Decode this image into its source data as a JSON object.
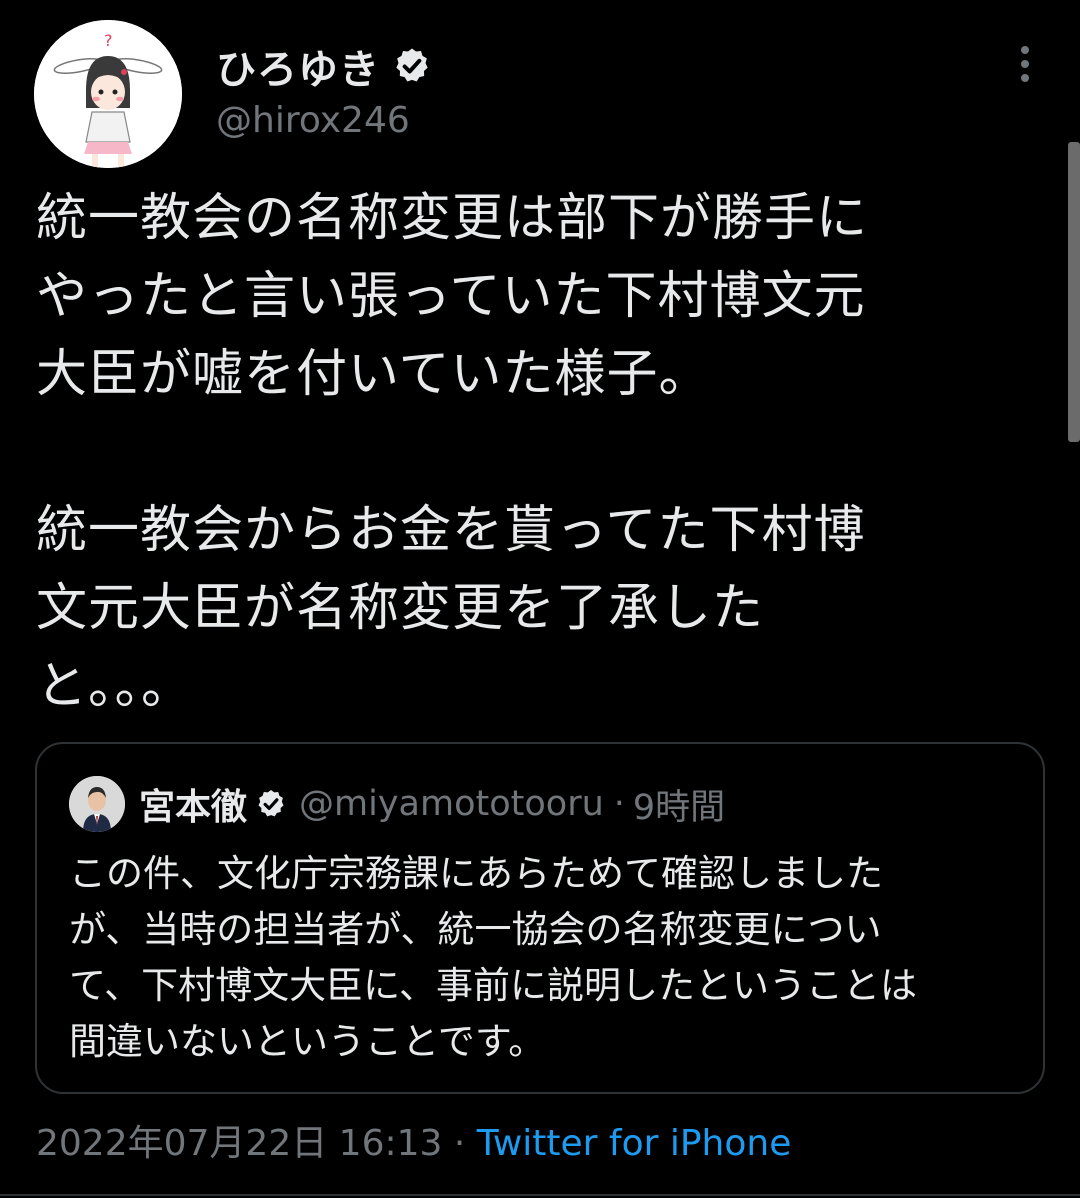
{
  "author": {
    "display_name": "ひろゆき",
    "handle": "@hirox246",
    "verified": true,
    "avatar_icon": "avatar-bunny-girl-icon"
  },
  "tweet": {
    "text": "統一教会の名称変更は部下が勝手に\nやったと言い張っていた下村博文元\n大臣が嘘を付いていた様子。\n\n統一教会からお金を貰ってた下村博\n文元大臣が名称変更を了承した\nと。。。"
  },
  "quote": {
    "display_name": "宮本徹",
    "handle": "@miyamototooru",
    "separator": "·",
    "time": "9時間",
    "verified": true,
    "text": "この件、文化庁宗務課にあらためて確認しました\nが、当時の担当者が、統一協会の名称変更につい\nて、下村博文大臣に、事前に説明したということは\n間違いないということです。"
  },
  "meta": {
    "timestamp": "2022年07月22日 16:13",
    "separator": "·",
    "source": "Twitter for iPhone"
  },
  "colors": {
    "background": "#000000",
    "text": "#e7e9ea",
    "muted": "#71767b",
    "accent": "#1d9bf0",
    "border": "#2f3336"
  }
}
